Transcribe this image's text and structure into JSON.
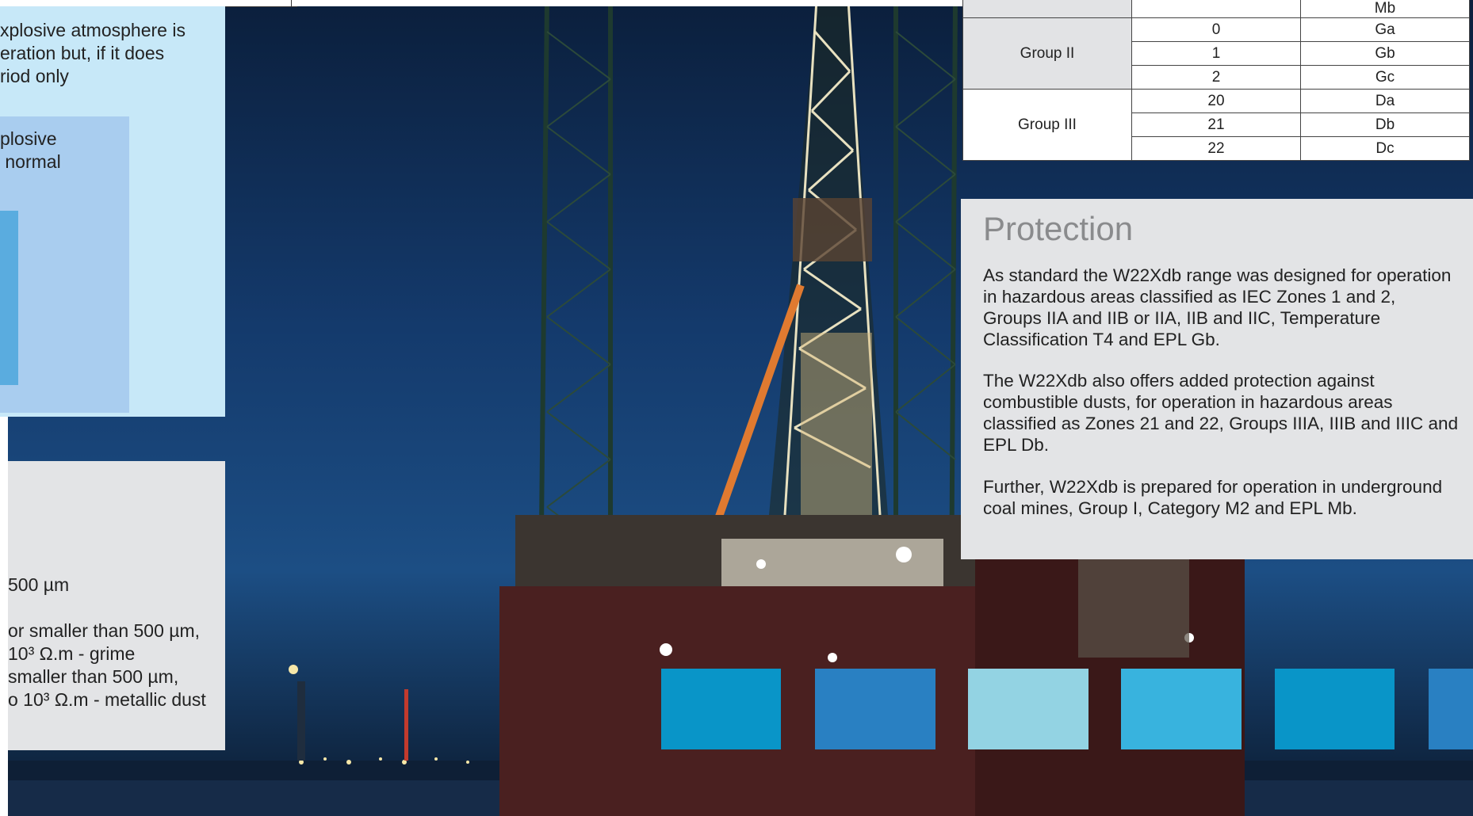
{
  "left_panel": {
    "lines": [
      "xplosive atmosphere is",
      "eration but, if it does",
      "riod only"
    ],
    "inner_lines": [
      "plosive",
      " normal"
    ]
  },
  "dust_panel": {
    "line1": "500 µm",
    "line2": "or smaller than 500 µm,",
    "line3": "10³ Ω.m - grime",
    "line4": "smaller than 500 µm,",
    "line5": "o 10³ Ω.m - metallic dust"
  },
  "epl_table": {
    "header_partial": "Mb",
    "groups": [
      {
        "name": "Group II",
        "rows": [
          {
            "zone": "0",
            "epl": "Ga"
          },
          {
            "zone": "1",
            "epl": "Gb"
          },
          {
            "zone": "2",
            "epl": "Gc"
          }
        ]
      },
      {
        "name": "Group III",
        "rows": [
          {
            "zone": "20",
            "epl": "Da"
          },
          {
            "zone": "21",
            "epl": "Db"
          },
          {
            "zone": "22",
            "epl": "Dc"
          }
        ]
      }
    ]
  },
  "protection": {
    "title": "Protection",
    "p1": "As standard the W22Xdb range was designed for operation in hazardous areas classified as IEC Zones 1 and 2, Groups IIA and IIB or IIA, IIB and IIC, Temperature Classification T4 and EPL Gb.",
    "p2": "The W22Xdb also offers added protection against combustible dusts, for operation in hazardous areas classified as Zones 21 and 22, Groups IIIA, IIIB and IIIC and EPL Db.",
    "p3": "Further, W22Xdb is prepared for operation in underground coal mines, Group I, Category M2 and EPL Mb."
  },
  "swatches": [
    "#0995c8",
    "#2980c2",
    "#93d3e3",
    "#38b3de",
    "#0995c8",
    "#2980c2"
  ],
  "colors": {
    "light_blue": "#c7e8f8",
    "mid_blue": "#a9cdef",
    "deep_blue": "#5aacdf",
    "grey": "#e3e4e6"
  }
}
